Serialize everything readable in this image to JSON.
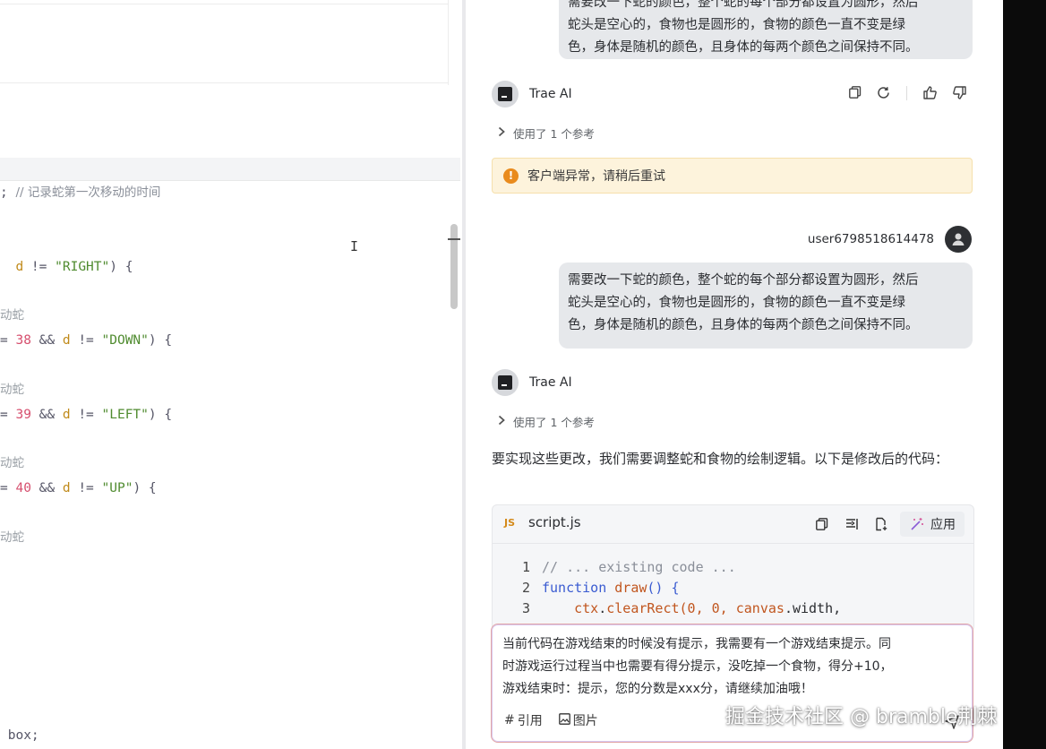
{
  "editor": {
    "code_lines": [
      {
        "segments": [
          {
            "t": "; ",
            "c": "op"
          },
          {
            "t": "// 记录蛇第一次移动的时间",
            "c": "cmt"
          }
        ]
      },
      {
        "segments": [
          {
            "t": "  d",
            "c": "kw"
          },
          {
            "t": " != ",
            "c": "op"
          },
          {
            "t": "\"RIGHT\"",
            "c": "str"
          },
          {
            "t": ") {",
            "c": "op"
          }
        ]
      },
      {
        "segments": [
          {
            "t": "动蛇",
            "c": "dim"
          }
        ]
      },
      {
        "segments": [
          {
            "t": "= ",
            "c": "op"
          },
          {
            "t": "38",
            "c": "num"
          },
          {
            "t": " && ",
            "c": "op"
          },
          {
            "t": "d",
            "c": "kw"
          },
          {
            "t": " != ",
            "c": "op"
          },
          {
            "t": "\"DOWN\"",
            "c": "str"
          },
          {
            "t": ") {",
            "c": "op"
          }
        ]
      },
      {
        "segments": [
          {
            "t": "动蛇",
            "c": "dim"
          }
        ]
      },
      {
        "segments": [
          {
            "t": "= ",
            "c": "op"
          },
          {
            "t": "39",
            "c": "num"
          },
          {
            "t": " && ",
            "c": "op"
          },
          {
            "t": "d",
            "c": "kw"
          },
          {
            "t": " != ",
            "c": "op"
          },
          {
            "t": "\"LEFT\"",
            "c": "str"
          },
          {
            "t": ") {",
            "c": "op"
          }
        ]
      },
      {
        "segments": [
          {
            "t": "动蛇",
            "c": "dim"
          }
        ]
      },
      {
        "segments": [
          {
            "t": "= ",
            "c": "op"
          },
          {
            "t": "40",
            "c": "num"
          },
          {
            "t": " && ",
            "c": "op"
          },
          {
            "t": "d",
            "c": "kw"
          },
          {
            "t": " != ",
            "c": "op"
          },
          {
            "t": "\"UP\"",
            "c": "str"
          },
          {
            "t": ") {",
            "c": "op"
          }
        ]
      },
      {
        "segments": [
          {
            "t": "动蛇",
            "c": "dim"
          }
        ]
      },
      {
        "segments": [
          {
            "t": " box;",
            "c": "op"
          }
        ]
      }
    ]
  },
  "chat": {
    "prev_user_message": "需要改一下蛇的颜色，整个蛇的每个部分都设置为圆形，然后蛇头是空心的，食物也是圆形的，食物的颜色一直不变是绿色，身体是随机的颜色，且身体的每两个颜色之间保持不同。",
    "prev_user_message_lines": [
      "需要改一下蛇的颜色，整个蛇的每个部分都设置为圆形，然后",
      "蛇头是空心的，食物也是圆形的，食物的颜色一直不变是绿",
      "色，身体是随机的颜色，且身体的每两个颜色之间保持不同。"
    ],
    "ai_name": "Trae AI",
    "ref_label": "使用了 1 个参考",
    "error_text": "客户端异常，请稍后重试",
    "user_name": "user6798518614478",
    "user_message_lines": [
      "需要改一下蛇的颜色，整个蛇的每个部分都设置为圆形，然后",
      "蛇头是空心的，食物也是圆形的，食物的颜色一直不变是绿",
      "色，身体是随机的颜色，且身体的每两个颜色之间保持不同。"
    ],
    "answer_text": "要实现这些更改，我们需要调整蛇和食物的绘制逻辑。以下是修改后的代码：",
    "code_block": {
      "lang_badge": "JS",
      "filename": "script.js",
      "apply_label": "应用",
      "lines": [
        {
          "n": "1",
          "parts": [
            {
              "t": "// ... existing code ...",
              "c": "c-cmt"
            }
          ]
        },
        {
          "n": "2",
          "parts": [
            {
              "t": "function ",
              "c": "c-kw"
            },
            {
              "t": "draw",
              "c": "c-fn"
            },
            {
              "t": "() {",
              "c": "c-kw"
            }
          ]
        },
        {
          "n": "3",
          "parts": [
            {
              "t": "    ctx",
              "c": "c-fn"
            },
            {
              "t": ".",
              "c": "c-plain"
            },
            {
              "t": "clearRect",
              "c": "c-fn"
            },
            {
              "t": "(0, 0, ",
              "c": "c-fn"
            },
            {
              "t": "canvas",
              "c": "c-fn"
            },
            {
              "t": ".width,",
              "c": "c-plain"
            }
          ]
        }
      ]
    },
    "input_text": "当前代码在游戏结束的时候没有提示，我需要有一个游戏结束提示。同时游戏运行过程当中也需要有得分提示，没吃掉一个食物，得分+10，游戏结束时：提示，您的分数是xxx分，请继续加油哦！",
    "input_text_lines": [
      "当前代码在游戏结束的时候没有提示，我需要有一个游戏结束提示。同",
      "时游戏运行过程当中也需要有得分提示，没吃掉一个食物，得分+10，",
      "游戏结束时：提示，您的分数是xxx分，请继续加油哦！"
    ],
    "footer_ref": "引用",
    "footer_image": "图片",
    "watermark": "掘金技术社区 @ bramble荆棘"
  }
}
